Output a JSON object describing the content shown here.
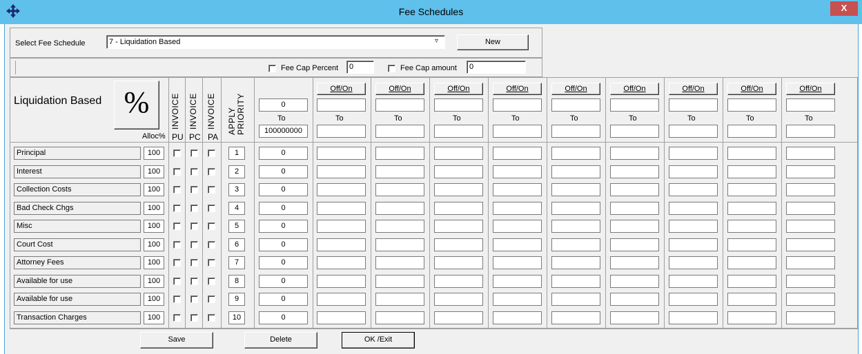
{
  "window": {
    "title": "Fee Schedules",
    "close_label": "X"
  },
  "top": {
    "select_label": "Select Fee Schedule",
    "select_value": "7 - Liquidation Based",
    "new_label": "New",
    "fee_cap_percent_label": "Fee Cap Percent",
    "fee_cap_percent_value": "0",
    "fee_cap_amount_label": "Fee Cap amount",
    "fee_cap_amount_value": "0"
  },
  "grid": {
    "schedule_name": "Liquidation Based",
    "percent_symbol": "%",
    "alloc_label": "Alloc%",
    "invoice_label": "INVOICE",
    "pu_label": "PU",
    "pc_label": "PC",
    "pa_label": "PA",
    "apply_priority_label": "APPLY PRIORITY",
    "first_tier": {
      "from": "0",
      "to_label": "To",
      "to": "100000000"
    },
    "tier_toggle_label": "Off/On",
    "tier_to_label": "To",
    "rows": [
      {
        "label": "Principal",
        "alloc": "100",
        "priority": "1",
        "value": "0"
      },
      {
        "label": "Interest",
        "alloc": "100",
        "priority": "2",
        "value": "0"
      },
      {
        "label": "Collection Costs",
        "alloc": "100",
        "priority": "3",
        "value": "0"
      },
      {
        "label": "Bad Check Chgs",
        "alloc": "100",
        "priority": "4",
        "value": "0"
      },
      {
        "label": "Misc",
        "alloc": "100",
        "priority": "5",
        "value": "0"
      },
      {
        "label": "Court Cost",
        "alloc": "100",
        "priority": "6",
        "value": "0"
      },
      {
        "label": "Attorney Fees",
        "alloc": "100",
        "priority": "7",
        "value": "0"
      },
      {
        "label": "Available for use",
        "alloc": "100",
        "priority": "8",
        "value": "0"
      },
      {
        "label": "Available for use",
        "alloc": "100",
        "priority": "9",
        "value": "0"
      },
      {
        "label": "Transaction Charges",
        "alloc": "100",
        "priority": "10",
        "value": "0"
      }
    ]
  },
  "bottom": {
    "save_label": "Save",
    "delete_label": "Delete",
    "ok_label": "OK /Exit"
  },
  "colors": {
    "titlebar": "#5ec0eb",
    "close": "#c75050",
    "window_bg": "#f0f0f0"
  }
}
